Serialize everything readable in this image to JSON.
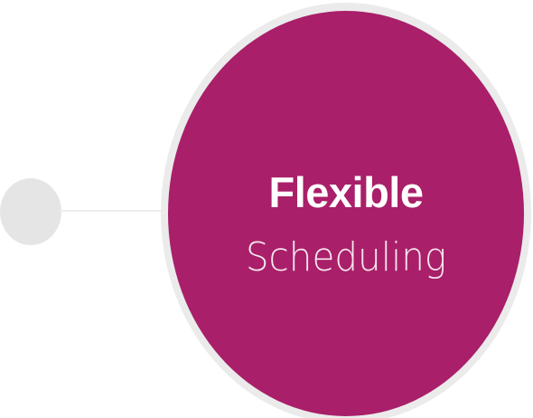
{
  "feature": {
    "title": "Flexible",
    "subtitle": "Scheduling"
  },
  "colors": {
    "circle_fill": "#a91f69",
    "circle_ring": "#ebebeb",
    "node_fill": "#e5e5e5",
    "connector": "#eeeeee",
    "text": "#ffffff"
  }
}
